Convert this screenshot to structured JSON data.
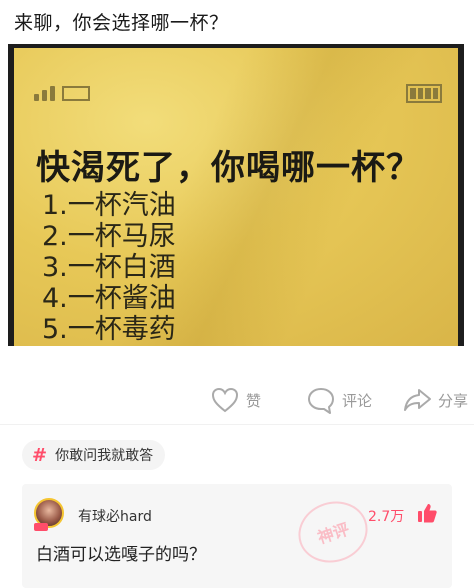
{
  "post": {
    "title": "来聊，你会选择哪一杯？"
  },
  "meme": {
    "question": "快渴死了，你喝哪一杯？",
    "options": [
      "1.一杯汽油",
      "2.一杯马尿",
      "3.一杯白酒",
      "4.一杯酱油",
      "5.一杯毒药"
    ],
    "background_color": "#e7c857"
  },
  "actions": {
    "like_label": "赞",
    "comment_label": "评论",
    "share_label": "分享"
  },
  "topic": {
    "label": "你敢问我就敢答"
  },
  "top_comment": {
    "username": "有球必hard",
    "stamp_text": "神评",
    "like_count": "2.7万",
    "text": "白酒可以选嘎子的吗？"
  },
  "colors": {
    "accent": "#ff4d6a",
    "muted": "#999999"
  },
  "icons": {
    "like": "heart-icon",
    "comment": "comment-bubble-icon",
    "share": "share-arrow-icon",
    "topic": "hashtag-icon",
    "thumb": "thumbs-up-icon"
  }
}
